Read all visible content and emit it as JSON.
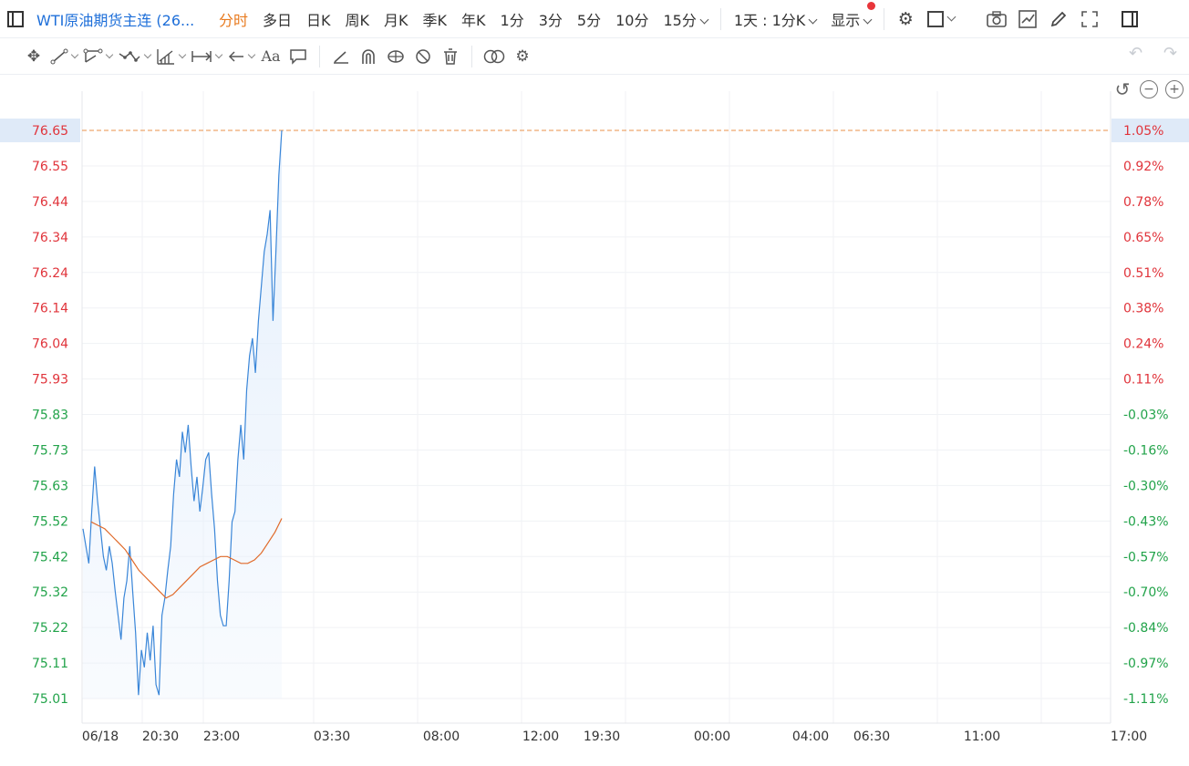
{
  "topbar": {
    "symbol": "WTI原油期货主连 (26...",
    "periods": [
      "分时",
      "多日",
      "日K",
      "周K",
      "月K",
      "季K",
      "年K",
      "1分",
      "3分",
      "5分",
      "10分",
      "15分"
    ],
    "active_period": "分时",
    "more_periods_label": "15分",
    "range_label": "1天 : 1分K",
    "display_label": "显示"
  },
  "chart_data": {
    "type": "line",
    "x_tick_labels": [
      "06/18",
      "20:30",
      "23:00",
      "03:30",
      "08:00",
      "12:00",
      "19:30",
      "00:00",
      "04:00",
      "06:30",
      "11:00",
      "17:00"
    ],
    "y_tick_labels": [
      "76.65",
      "76.55",
      "76.44",
      "76.34",
      "76.24",
      "76.14",
      "76.04",
      "75.93",
      "75.83",
      "75.73",
      "75.63",
      "75.52",
      "75.42",
      "75.32",
      "75.22",
      "75.11",
      "75.01"
    ],
    "pct_tick_labels": [
      "1.05%",
      "0.92%",
      "0.78%",
      "0.65%",
      "0.51%",
      "0.38%",
      "0.24%",
      "0.11%",
      "-0.03%",
      "-0.16%",
      "-0.30%",
      "-0.43%",
      "-0.57%",
      "-0.70%",
      "-0.84%",
      "-0.97%",
      "-1.11%"
    ],
    "ylim": [
      75.01,
      76.65
    ],
    "last_price": "76.65",
    "last_pct": "1.05%",
    "series": [
      {
        "kind": "price",
        "color": "#3a86d8",
        "fill": "#e6f0fc",
        "values": [
          75.5,
          75.45,
          75.4,
          75.55,
          75.68,
          75.58,
          75.5,
          75.42,
          75.38,
          75.45,
          75.4,
          75.32,
          75.25,
          75.18,
          75.3,
          75.35,
          75.45,
          75.32,
          75.2,
          75.02,
          75.15,
          75.1,
          75.2,
          75.12,
          75.22,
          75.05,
          75.02,
          75.25,
          75.3,
          75.38,
          75.45,
          75.6,
          75.7,
          75.65,
          75.78,
          75.72,
          75.8,
          75.68,
          75.58,
          75.65,
          75.55,
          75.62,
          75.7,
          75.72,
          75.6,
          75.5,
          75.35,
          75.25,
          75.22,
          75.22,
          75.35,
          75.52,
          75.55,
          75.7,
          75.8,
          75.7,
          75.9,
          76.0,
          76.05,
          75.95,
          76.1,
          76.2,
          76.3,
          76.35,
          76.42,
          76.1,
          76.3,
          76.52,
          76.65
        ]
      },
      {
        "kind": "average",
        "color": "#e06a2a",
        "values": [
          75.52,
          75.51,
          75.5,
          75.48,
          75.46,
          75.44,
          75.41,
          75.38,
          75.36,
          75.34,
          75.32,
          75.3,
          75.31,
          75.33,
          75.35,
          75.37,
          75.39,
          75.4,
          75.41,
          75.42,
          75.42,
          75.41,
          75.4,
          75.4,
          75.41,
          75.43,
          75.46,
          75.49,
          75.53
        ]
      }
    ]
  }
}
